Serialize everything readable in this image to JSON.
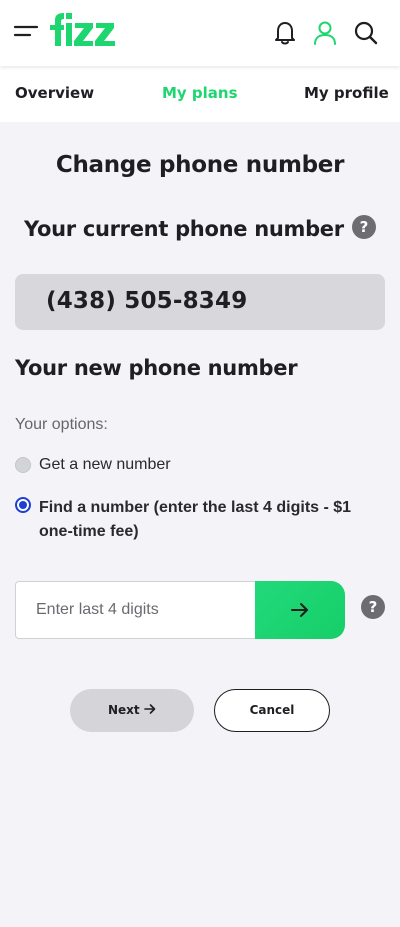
{
  "header": {
    "logo_text": "fizz",
    "icons": [
      "menu-icon",
      "bell-icon",
      "user-icon",
      "search-icon"
    ]
  },
  "tabs": [
    {
      "label": "Overview",
      "active": false
    },
    {
      "label": "My plans",
      "active": true
    },
    {
      "label": "My profile",
      "active": false
    }
  ],
  "main": {
    "title": "Change phone number",
    "current_heading": "Your current phone number",
    "current_number": "(438) 505-8349",
    "new_heading": "Your new phone number",
    "options_label": "Your options:",
    "options": [
      {
        "label": "Get a new number",
        "selected": false
      },
      {
        "label": "Find a number (enter the last 4 digits - $1 one-time fee)",
        "selected": true
      }
    ],
    "digits_placeholder": "Enter last 4 digits",
    "help_symbol": "?",
    "next_label": "Next",
    "cancel_label": "Cancel"
  },
  "colors": {
    "brand_green": "#1ed66f",
    "radio_blue": "#1f3fd1",
    "background": "#f4f3f8"
  }
}
